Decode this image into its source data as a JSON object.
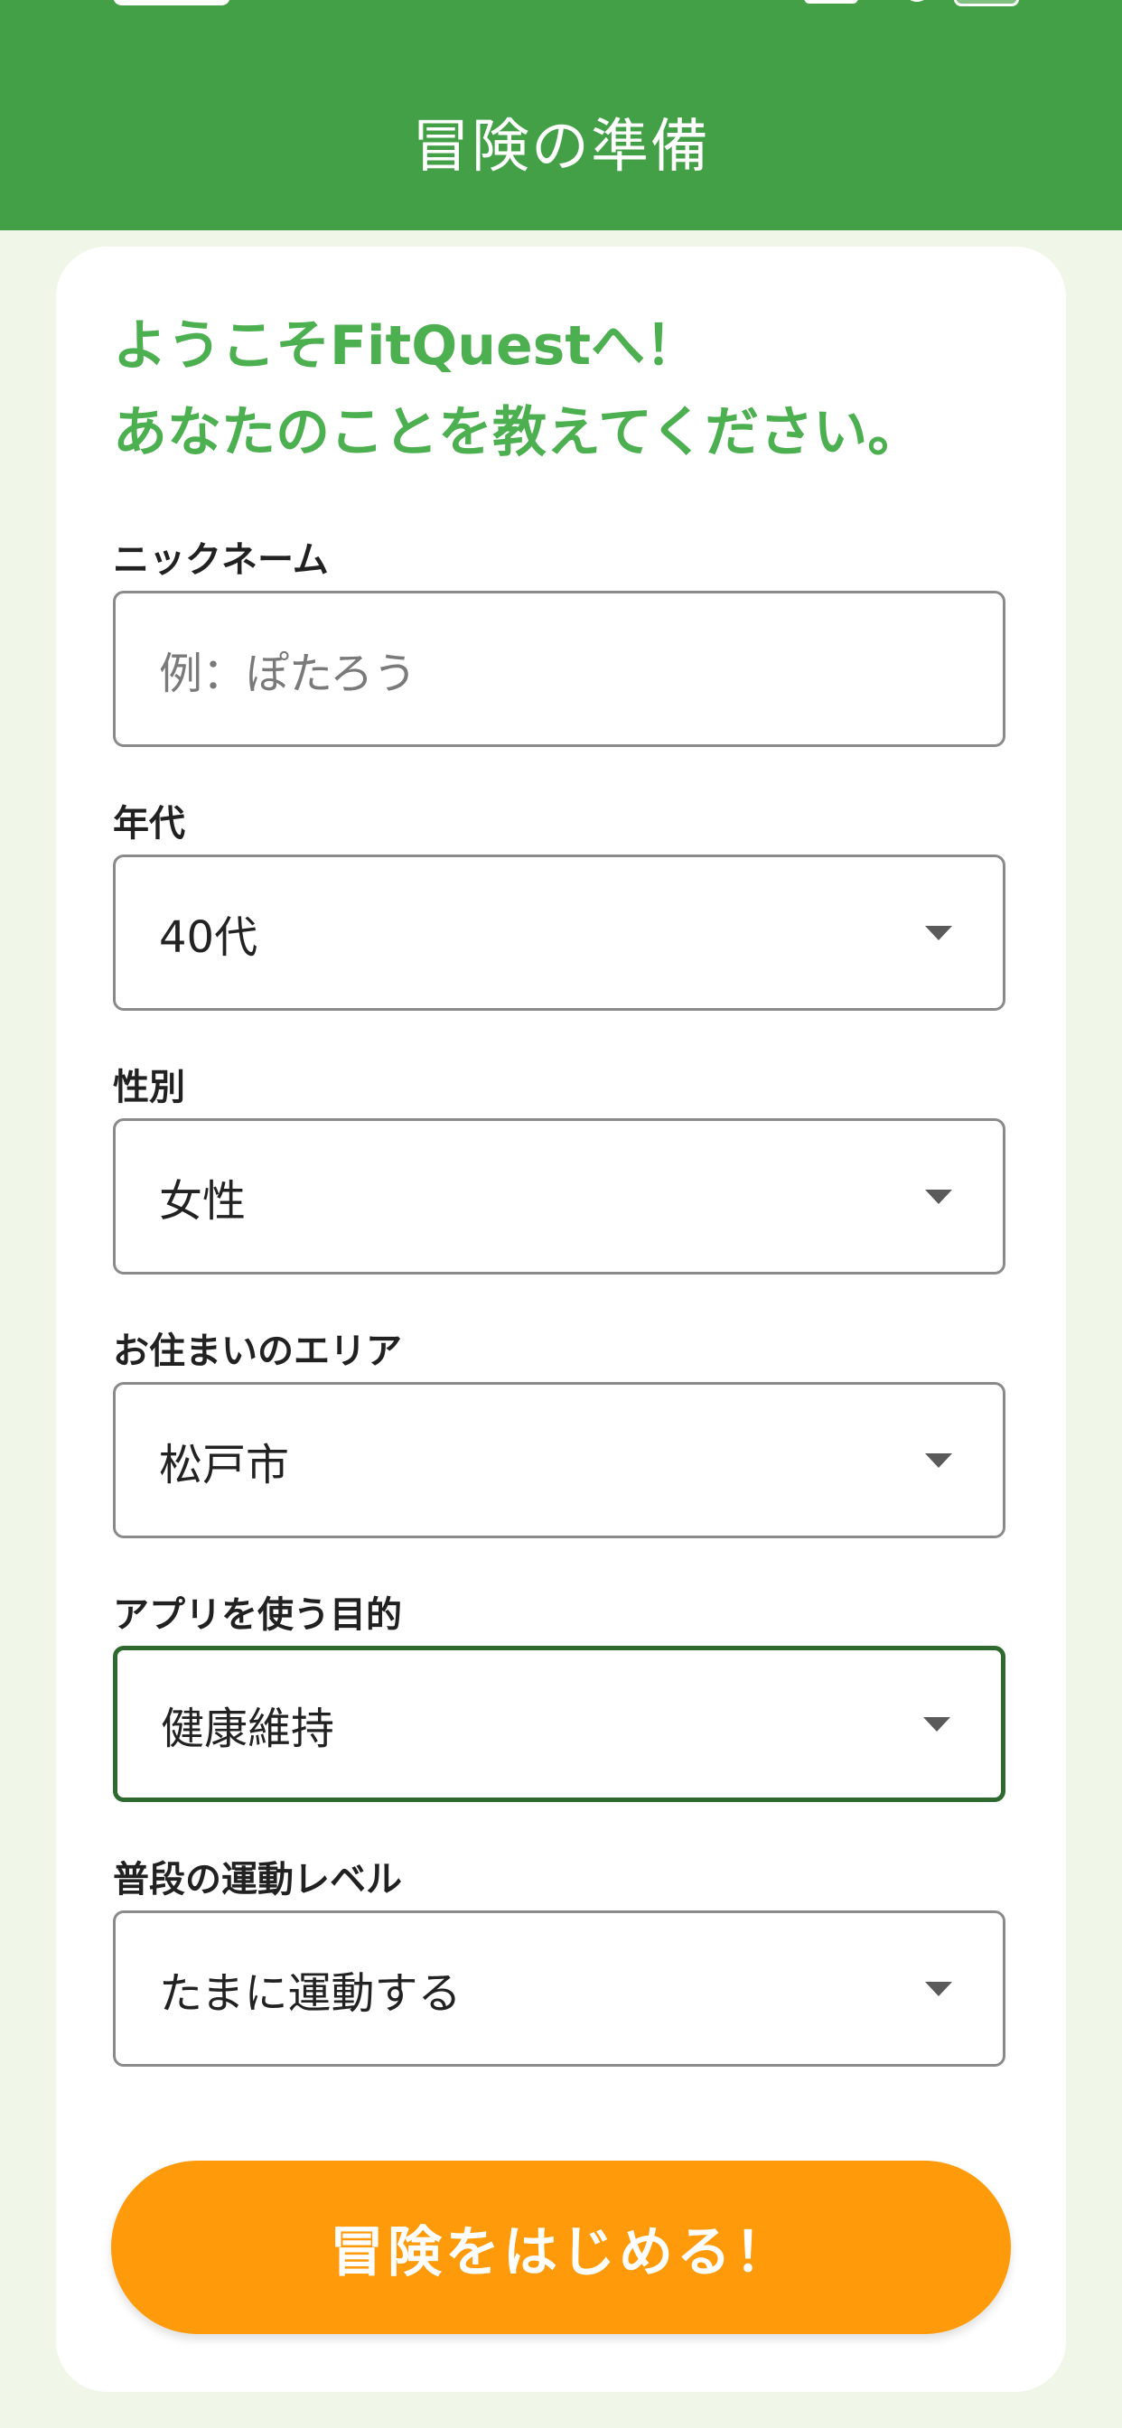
{
  "header": {
    "title": "冒険の準備"
  },
  "colors": {
    "header_bg": "#43a047",
    "page_bg": "#f0f6e8",
    "welcome_text": "#4caf50",
    "button_bg": "#ff9a0a",
    "focused_border": "#2e6a30"
  },
  "welcome": {
    "line1": "ようこそFitQuestへ！",
    "line2": "あなたのことを教えてください。"
  },
  "form": {
    "nickname": {
      "label": "ニックネーム",
      "placeholder": "例：ぽたろう",
      "value": ""
    },
    "age": {
      "label": "年代",
      "value": "40代"
    },
    "gender": {
      "label": "性別",
      "value": "女性"
    },
    "area": {
      "label": "お住まいのエリア",
      "value": "松戸市"
    },
    "purpose": {
      "label": "アプリを使う目的",
      "value": "健康維持"
    },
    "activity": {
      "label": "普段の運動レベル",
      "value": "たまに運動する"
    }
  },
  "submit": {
    "label": "冒険をはじめる！"
  }
}
